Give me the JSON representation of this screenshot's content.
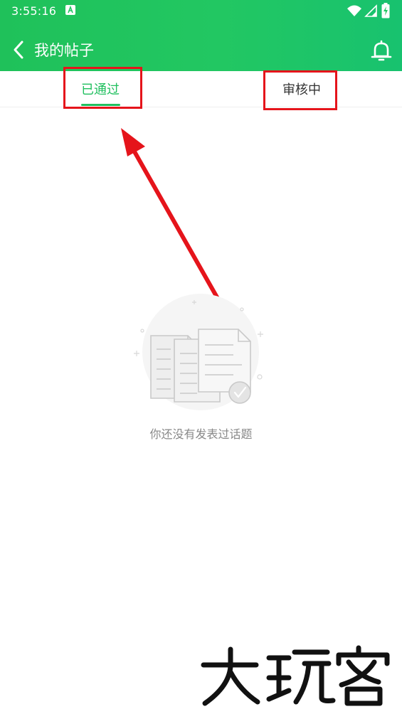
{
  "status_bar": {
    "time": "3:55:16"
  },
  "header": {
    "title": "我的帖子",
    "back_icon": "chevron-left-icon",
    "bell_icon": "bell-icon",
    "accent": "#22c762"
  },
  "tabs": [
    {
      "label": "已通过",
      "selected": true,
      "color": "#1fbf5e"
    },
    {
      "label": "审核中",
      "selected": false,
      "color": "#333333"
    }
  ],
  "empty_state": {
    "message": "你还没有发表过话题",
    "icon": "documents-check-illustration"
  },
  "annotation": {
    "color": "#e5141b"
  },
  "watermark": {
    "text": "大玩客"
  }
}
